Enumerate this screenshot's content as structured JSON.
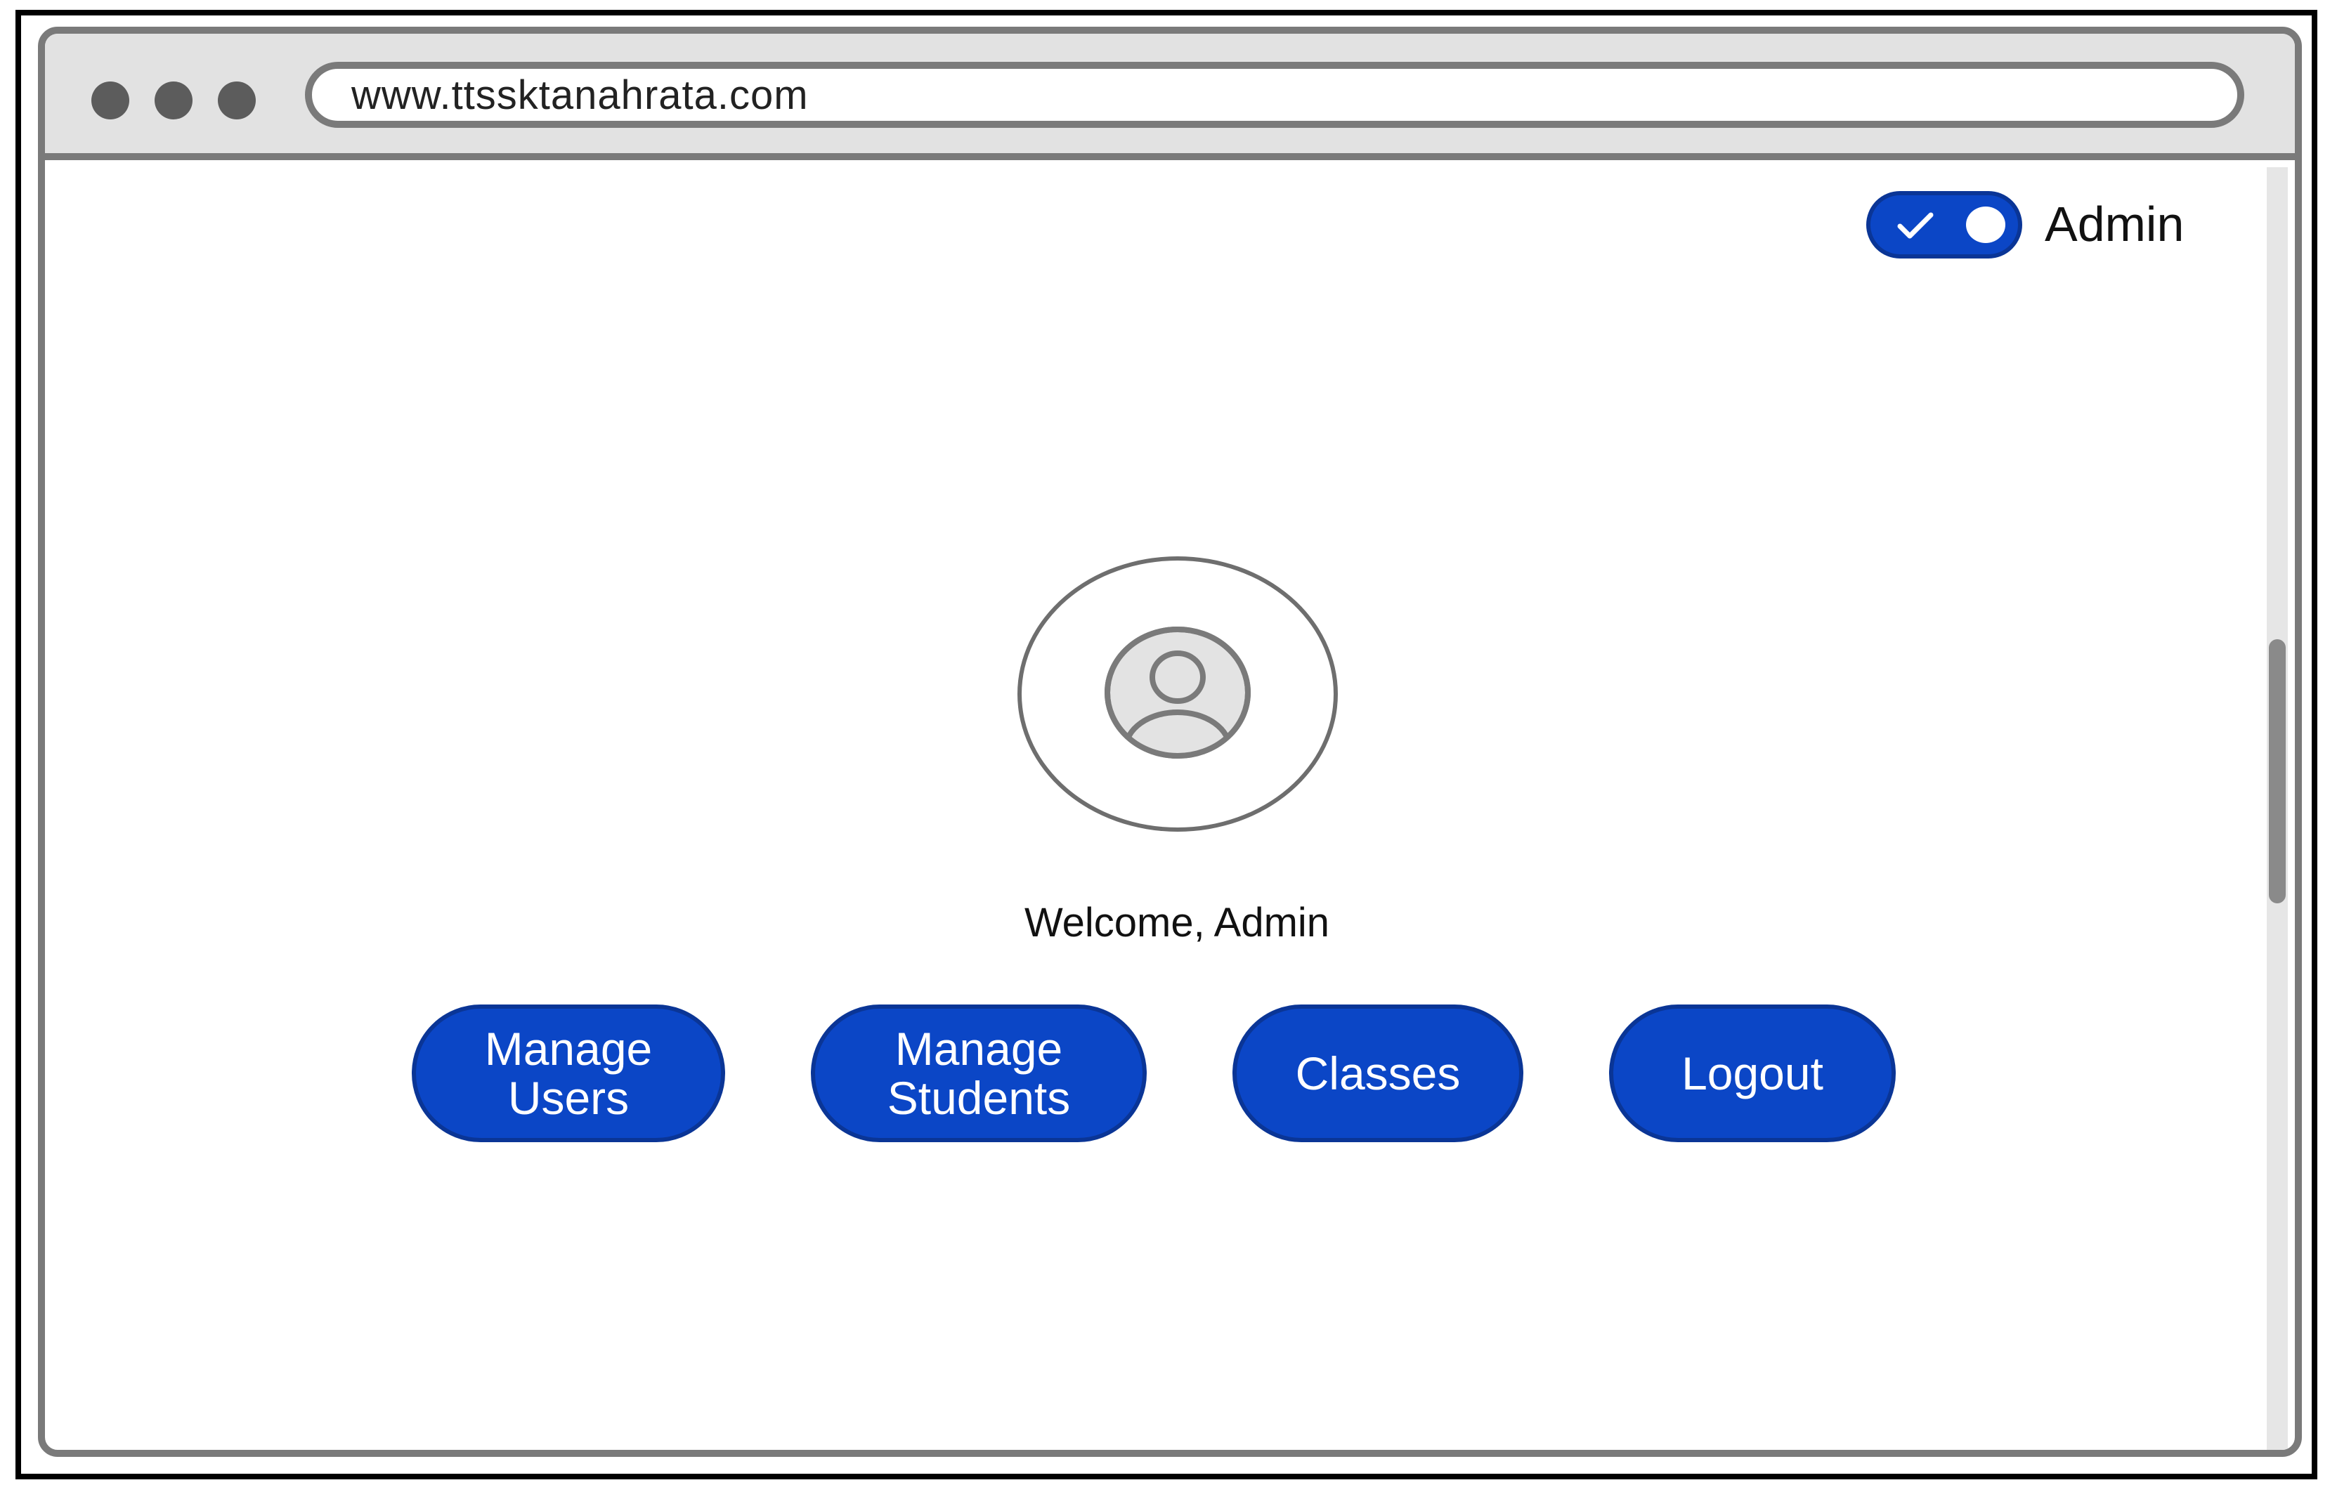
{
  "browser": {
    "url": "www.ttssktanahrata.com"
  },
  "header": {
    "toggle_label": "Admin",
    "toggle_state": "on"
  },
  "profile": {
    "welcome": "Welcome, Admin"
  },
  "actions": {
    "manage_users_line1": "Manage",
    "manage_users_line2": "Users",
    "manage_students_line1": "Manage",
    "manage_students_line2": "Students",
    "classes": "Classes",
    "logout": "Logout"
  },
  "colors": {
    "accent": "#0b46c6",
    "accent_border": "#0a3596",
    "chrome": "#e2e2e2",
    "chrome_border": "#7a7a7a"
  },
  "icons": {
    "avatar": "user-avatar-icon",
    "toggle": "check-icon"
  }
}
